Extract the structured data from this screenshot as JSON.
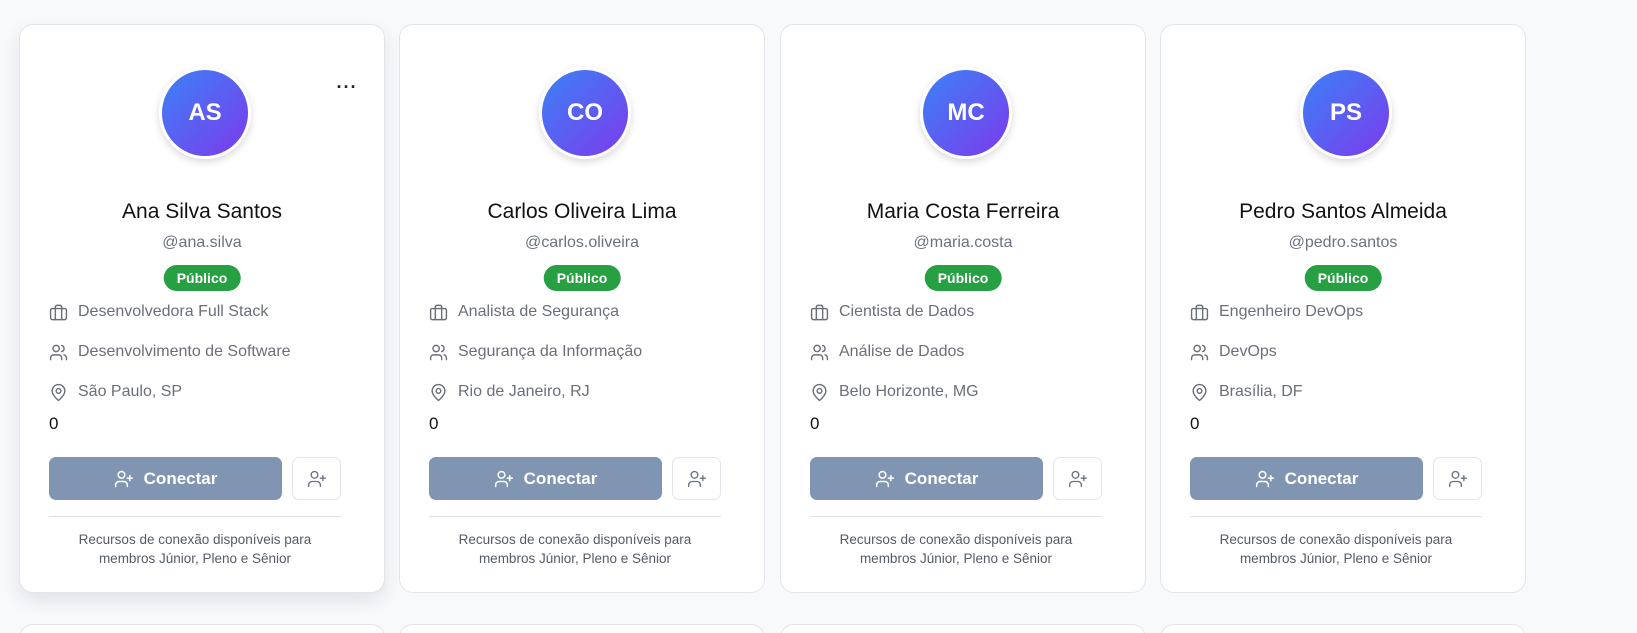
{
  "profiles": [
    {
      "initials": "AS",
      "name": "Ana Silva Santos",
      "handle": "@ana.silva",
      "visibility": "Público",
      "role": "Desenvolvedora Full Stack",
      "department": "Desenvolvimento de Software",
      "location": "São Paulo, SP",
      "count": "0",
      "connect_label": "Conectar",
      "note": "Recursos de conexão disponíveis para membros Júnior, Pleno e Sênior",
      "more_label": "···"
    },
    {
      "initials": "CO",
      "name": "Carlos Oliveira Lima",
      "handle": "@carlos.oliveira",
      "visibility": "Público",
      "role": "Analista de Segurança",
      "department": "Segurança da Informação",
      "location": "Rio de Janeiro, RJ",
      "count": "0",
      "connect_label": "Conectar",
      "note": "Recursos de conexão disponíveis para membros Júnior, Pleno e Sênior"
    },
    {
      "initials": "MC",
      "name": "Maria Costa Ferreira",
      "handle": "@maria.costa",
      "visibility": "Público",
      "role": "Cientista de Dados",
      "department": "Análise de Dados",
      "location": "Belo Horizonte, MG",
      "count": "0",
      "connect_label": "Conectar",
      "note": "Recursos de conexão disponíveis para membros Júnior, Pleno e Sênior"
    },
    {
      "initials": "PS",
      "name": "Pedro Santos Almeida",
      "handle": "@pedro.santos",
      "visibility": "Público",
      "role": "Engenheiro DevOps",
      "department": "DevOps",
      "location": "Brasília, DF",
      "count": "0",
      "connect_label": "Conectar",
      "note": "Recursos de conexão disponíveis para membros Júnior, Pleno e Sênior"
    }
  ],
  "colors": {
    "badge": "#26a043",
    "connect_button": "#7f95b1",
    "avatar_gradient_start": "#3b82f6",
    "avatar_gradient_end": "#7c3aed"
  }
}
